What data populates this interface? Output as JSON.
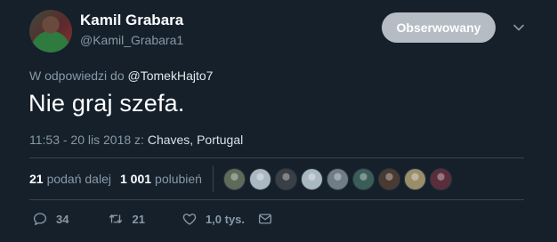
{
  "author": {
    "name": "Kamil Grabara",
    "handle": "@Kamil_Grabara1"
  },
  "follow_button": {
    "label": "Obserwowany"
  },
  "reply": {
    "prefix": "W odpowiedzi do ",
    "mention": "@TomekHajto7"
  },
  "tweet": {
    "text": "Nie graj szefa.",
    "timestamp": "11:53 - 20 lis 2018 z: ",
    "location": "Chaves, Portugal"
  },
  "stats": {
    "retweets_count": "21",
    "retweets_label": "podań dalej",
    "likes_count": "1 001",
    "likes_label": "polubień"
  },
  "likers": [
    {
      "color": "#5e6b5a"
    },
    {
      "color": "#aab8c2"
    },
    {
      "color": "#3a3f46"
    },
    {
      "color": "#aab8c2"
    },
    {
      "color": "#6f7d86"
    },
    {
      "color": "#3b5d58"
    },
    {
      "color": "#4a3a32"
    },
    {
      "color": "#9a8e6a"
    },
    {
      "color": "#5a2d3a"
    }
  ],
  "actions": {
    "replies": "34",
    "retweets": "21",
    "likes": "1,0 tys."
  },
  "colors": {
    "background": "#15202b",
    "secondary_text": "#8899a6",
    "follow_button": "#b5bcc4",
    "divider": "#38444d"
  }
}
